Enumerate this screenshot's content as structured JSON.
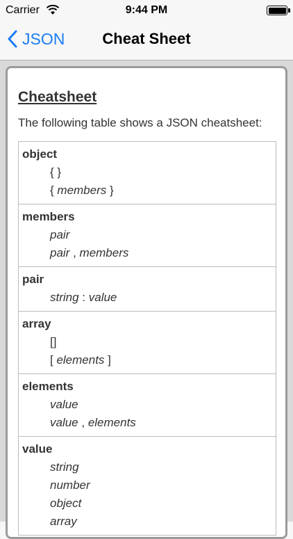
{
  "status_bar": {
    "carrier": "Carrier",
    "time": "9:44 PM",
    "icons": [
      "wifi-icon",
      "battery-icon"
    ]
  },
  "nav_bar": {
    "back_label": "JSON",
    "title": "Cheat Sheet",
    "accent_color": "#1a7cf5"
  },
  "content": {
    "heading": "Cheatsheet",
    "intro": "The following table shows a JSON cheatsheet:",
    "rules": [
      {
        "term": "object",
        "productions": [
          [
            {
              "t": "{ }",
              "i": false
            }
          ],
          [
            {
              "t": "{ ",
              "i": false
            },
            {
              "t": "members",
              "i": true
            },
            {
              "t": " }",
              "i": false
            }
          ]
        ]
      },
      {
        "term": "members",
        "productions": [
          [
            {
              "t": "pair",
              "i": true
            }
          ],
          [
            {
              "t": "pair",
              "i": true
            },
            {
              "t": " , ",
              "i": false
            },
            {
              "t": "members",
              "i": true
            }
          ]
        ]
      },
      {
        "term": "pair",
        "productions": [
          [
            {
              "t": "string",
              "i": true
            },
            {
              "t": " : ",
              "i": false
            },
            {
              "t": "value",
              "i": true
            }
          ]
        ]
      },
      {
        "term": "array",
        "productions": [
          [
            {
              "t": "[]",
              "i": false
            }
          ],
          [
            {
              "t": "[ ",
              "i": false
            },
            {
              "t": "elements",
              "i": true
            },
            {
              "t": " ]",
              "i": false
            }
          ]
        ]
      },
      {
        "term": "elements",
        "productions": [
          [
            {
              "t": "value",
              "i": true
            }
          ],
          [
            {
              "t": "value",
              "i": true
            },
            {
              "t": " , ",
              "i": false
            },
            {
              "t": "elements",
              "i": true
            }
          ]
        ]
      },
      {
        "term": "value",
        "productions": [
          [
            {
              "t": "string",
              "i": true
            }
          ],
          [
            {
              "t": "number",
              "i": true
            }
          ],
          [
            {
              "t": "object",
              "i": true
            }
          ],
          [
            {
              "t": "array",
              "i": true
            }
          ]
        ]
      }
    ]
  }
}
